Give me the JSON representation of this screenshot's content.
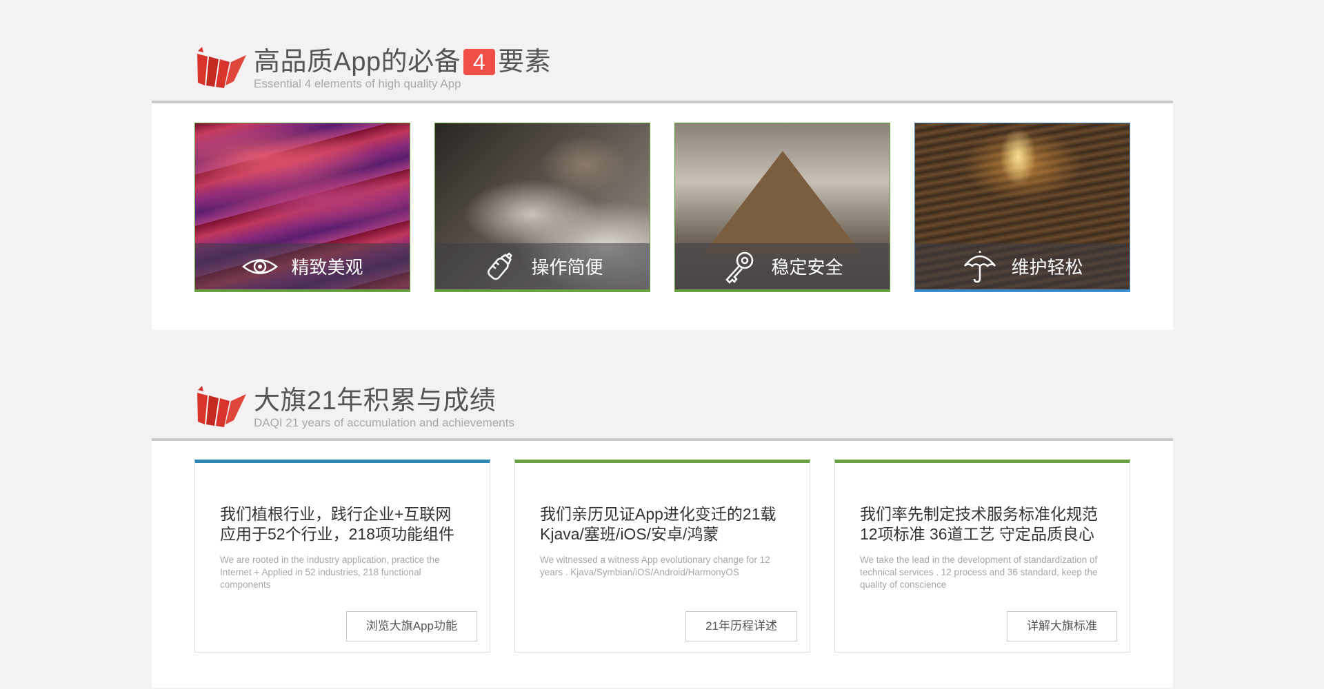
{
  "section1": {
    "title_before": "高品质App的必备",
    "badge": "4",
    "title_after": "要素",
    "subtitle": "Essential 4 elements of high quality App"
  },
  "features": [
    {
      "label": "精致美观",
      "icon": "eye-icon"
    },
    {
      "label": "操作简便",
      "icon": "baby-bottle-icon"
    },
    {
      "label": "稳定安全",
      "icon": "key-icon"
    },
    {
      "label": "维护轻松",
      "icon": "umbrella-icon"
    }
  ],
  "section2": {
    "title": "大旗21年积累与成绩",
    "subtitle": "DAQI 21 years of accumulation and achievements"
  },
  "achievements": [
    {
      "title_line1": "我们植根行业，践行企业+互联网",
      "title_line2": "应用于52个行业，218项功能组件",
      "desc": "We are rooted in the industry application, practice the Internet +       Applied in 52 industries, 218 functional components",
      "button": "浏览大旗App功能"
    },
    {
      "title_line1": "我们亲历见证App进化变迁的21载",
      "title_line2": "Kjava/塞班/iOS/安卓/鸿蒙",
      "desc": "We witnessed a witness App evolutionary change for 12 years .  Kjava/Symbian/iOS/Android/HarmonyOS",
      "button": "21年历程详述"
    },
    {
      "title_line1": "我们率先制定技术服务标准化规范",
      "title_line2": "12项标准  36道工艺  守定品质良心",
      "desc": "We take the lead in the development of standardization of technical services .   12 process and 36 standard, keep the quality of conscience",
      "button": "详解大旗标准"
    }
  ],
  "colors": {
    "accent_red": "#ef4f47",
    "green": "#6aa142",
    "blue": "#2d86b4",
    "logo_red": "#d9342b"
  }
}
